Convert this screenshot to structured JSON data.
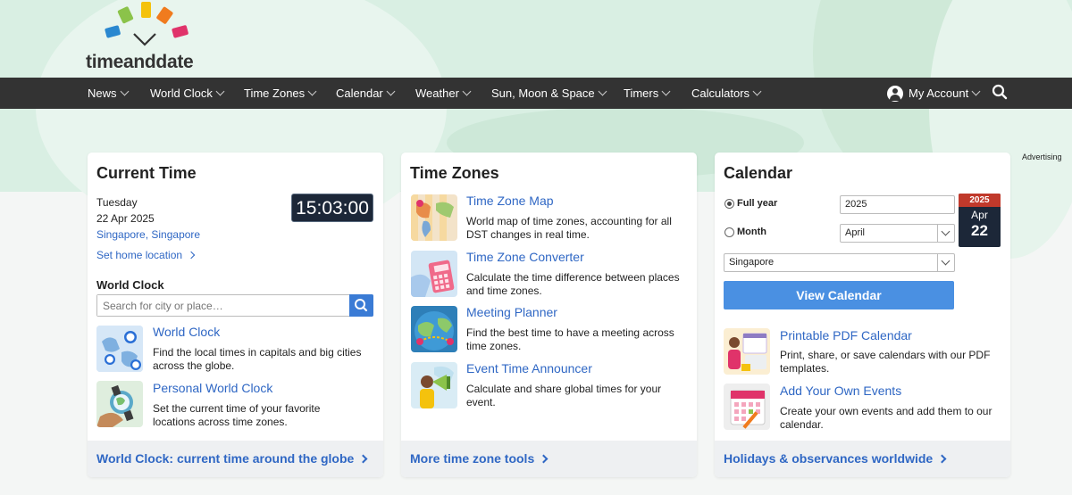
{
  "logo": {
    "text": "timeanddate"
  },
  "nav": {
    "items": [
      "News",
      "World Clock",
      "Time Zones",
      "Calendar",
      "Weather",
      "Sun, Moon & Space",
      "Timers",
      "Calculators"
    ],
    "account_label": "My Account"
  },
  "advertising_label": "Advertising",
  "current_time": {
    "title": "Current Time",
    "weekday": "Tuesday",
    "date": "22 Apr 2025",
    "location": "Singapore, Singapore",
    "set_home_location": "Set home location",
    "clock": "15:03:00",
    "world_clock_heading": "World Clock",
    "search_placeholder": "Search for city or place…",
    "items": [
      {
        "title": "World Clock",
        "desc": "Find the local times in capitals and big cities across the globe."
      },
      {
        "title": "Personal World Clock",
        "desc": "Set the current time of your favorite locations across time zones."
      }
    ],
    "footer_link": "World Clock: current time around the globe"
  },
  "time_zones": {
    "title": "Time Zones",
    "items": [
      {
        "title": "Time Zone Map",
        "desc": "World map of time zones, accounting for all DST changes in real time."
      },
      {
        "title": "Time Zone Converter",
        "desc": "Calculate the time difference between places and time zones."
      },
      {
        "title": "Meeting Planner",
        "desc": "Find the best time to have a meeting across time zones."
      },
      {
        "title": "Event Time Announcer",
        "desc": "Calculate and share global times for your event."
      }
    ],
    "footer_link": "More time zone tools"
  },
  "calendar": {
    "title": "Calendar",
    "full_year_label": "Full year",
    "month_label": "Month",
    "year_value": "2025",
    "month_value": "April",
    "country_value": "Singapore",
    "view_button": "View Calendar",
    "badge": {
      "year": "2025",
      "month": "Apr",
      "day": "22"
    },
    "items": [
      {
        "title": "Printable PDF Calendar",
        "desc": "Print, share, or save calendars with our PDF templates."
      },
      {
        "title": "Add Your Own Events",
        "desc": "Create your own events and add them to our calendar."
      }
    ],
    "footer_link": "Holidays & observances worldwide"
  },
  "colors": {
    "nav_bg": "#333333",
    "link": "#2f67c4",
    "button": "#4a90e2",
    "clock_bg": "#1c2738"
  }
}
